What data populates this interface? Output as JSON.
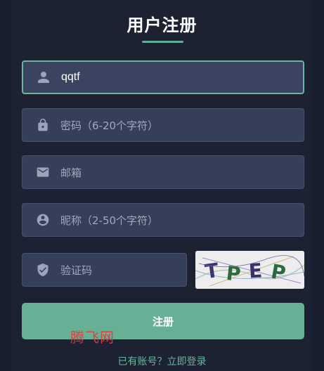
{
  "header": {
    "title": "用户注册"
  },
  "form": {
    "username": {
      "value": "qqtf",
      "icon": "person-icon"
    },
    "password": {
      "placeholder": "密码（6-20个字符）",
      "icon": "lock-icon"
    },
    "email": {
      "placeholder": "邮箱",
      "icon": "mail-icon"
    },
    "nickname": {
      "placeholder": "昵称（2-50个字符）",
      "icon": "account-circle-icon"
    },
    "captcha": {
      "placeholder": "验证码",
      "icon": "shield-check-icon",
      "image_text": "TPEP"
    },
    "submit_label": "注册"
  },
  "watermark": "腾飞网",
  "footer": {
    "login_link": "已有账号？立即登录"
  },
  "colors": {
    "background": "#1d2232",
    "field_background": "#363f5a",
    "accent": "#67b096",
    "active_border": "#6fb5a2",
    "watermark": "#e33a3a"
  }
}
